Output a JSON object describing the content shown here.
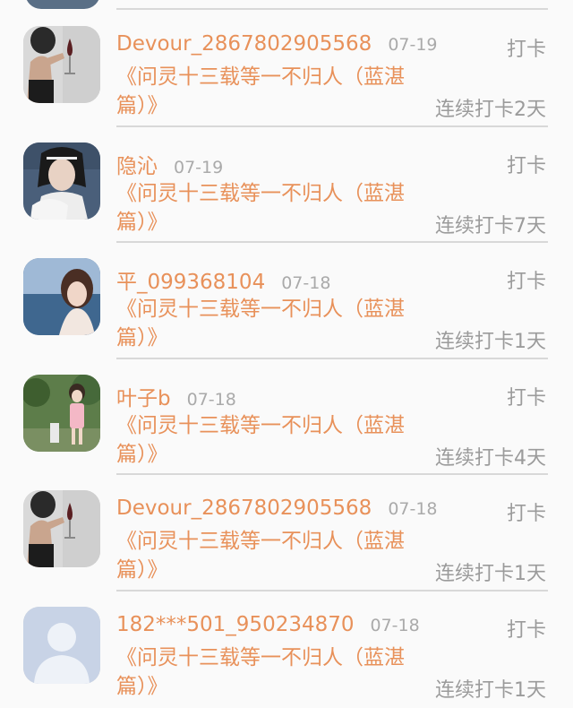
{
  "feed": {
    "items": [
      {
        "username": "Devour_2867802905568",
        "date": "07-19",
        "action": "打卡",
        "title": "《问灵十三载等一不归人（蓝湛篇）》",
        "streak": "连续打卡2天",
        "avatar_icon": "wine-glass-photo"
      },
      {
        "username": "隐沁",
        "date": "07-19",
        "action": "打卡",
        "title": "《问灵十三载等一不归人（蓝湛篇）》",
        "streak": "连续打卡7天",
        "avatar_icon": "costume-portrait-photo"
      },
      {
        "username": "平_099368104",
        "date": "07-18",
        "action": "打卡",
        "title": "《问灵十三载等一不归人（蓝湛篇）》",
        "streak": "连续打卡1天",
        "avatar_icon": "seaside-portrait-photo"
      },
      {
        "username": "叶子b",
        "date": "07-18",
        "action": "打卡",
        "title": "《问灵十三载等一不归人（蓝湛篇）》",
        "streak": "连续打卡4天",
        "avatar_icon": "garden-girl-photo"
      },
      {
        "username": "Devour_2867802905568",
        "date": "07-18",
        "action": "打卡",
        "title": "《问灵十三载等一不归人（蓝湛篇）》",
        "streak": "连续打卡1天",
        "avatar_icon": "wine-glass-photo"
      },
      {
        "username": "182***501_950234870",
        "date": "07-18",
        "action": "打卡",
        "title": "《问灵十三载等一不归人（蓝湛篇）》",
        "streak": "连续打卡1天",
        "avatar_icon": "default-user-silhouette"
      }
    ]
  },
  "colors": {
    "accent": "#e8915a",
    "muted_text": "#9b9b9b",
    "date_text": "#aaaaaa",
    "divider": "#d8d8d8",
    "background": "#fafafa"
  }
}
